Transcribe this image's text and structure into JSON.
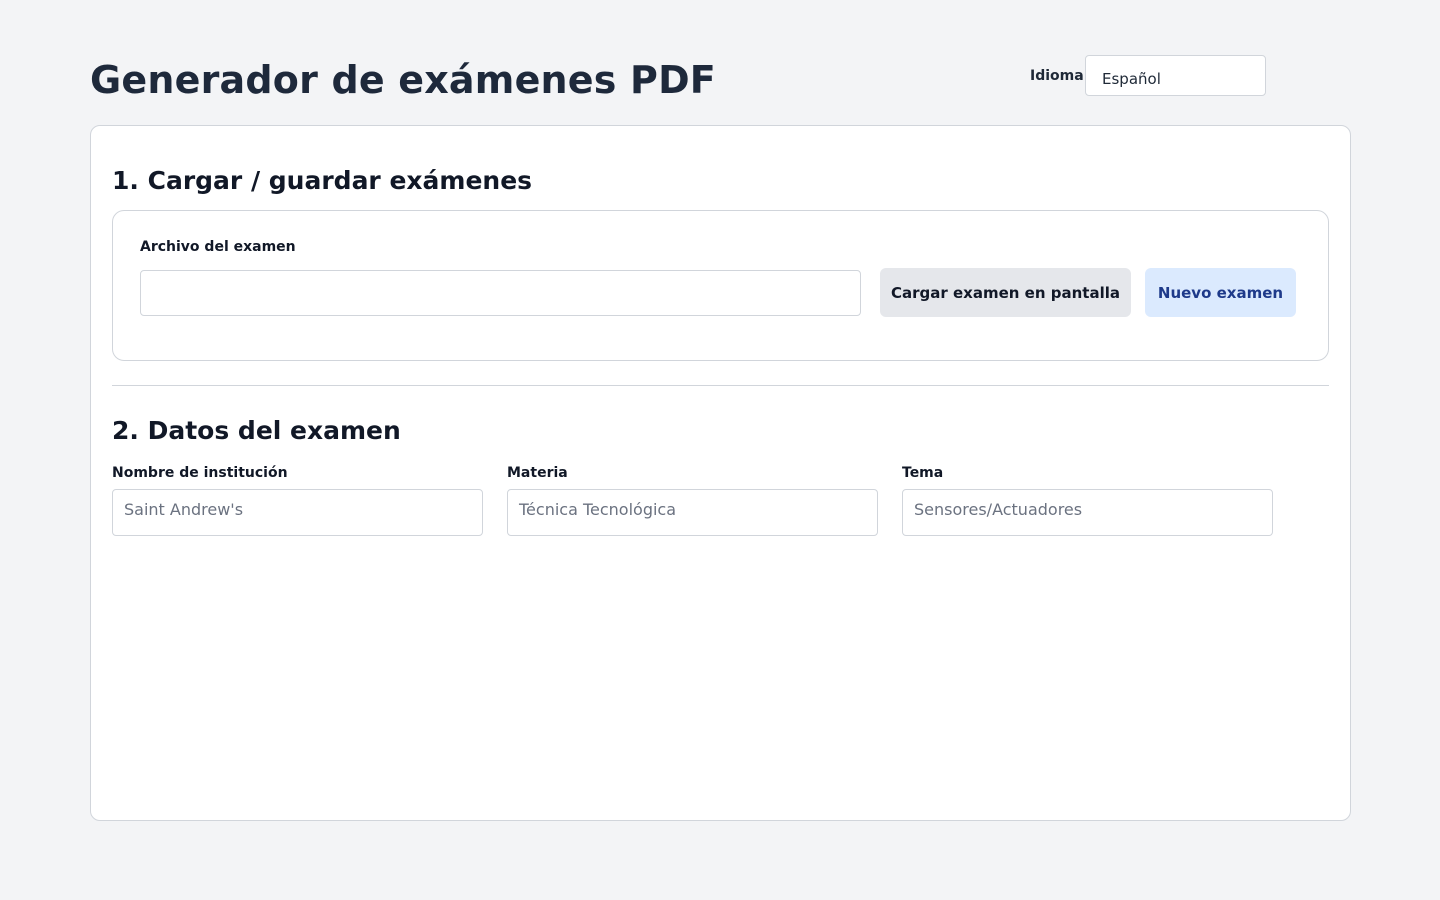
{
  "header": {
    "title": "Generador de exámenes PDF",
    "language_label": "Idioma",
    "language_value": "Español"
  },
  "section1": {
    "title": "1. Cargar / guardar exámenes",
    "file_label": "Archivo del examen",
    "file_value": "",
    "load_button": "Cargar examen en pantalla",
    "new_button": "Nuevo examen"
  },
  "section2": {
    "title": "2. Datos del examen",
    "fields": [
      {
        "label": "Nombre de institución",
        "placeholder": "Saint Andrew's"
      },
      {
        "label": "Materia",
        "placeholder": "Técnica Tecnológica"
      },
      {
        "label": "Tema",
        "placeholder": "Sensores/Actuadores"
      }
    ]
  },
  "colors": {
    "background": "#f3f4f6",
    "card": "#ffffff",
    "border": "#d1d5db",
    "load_button_bg": "#e5e7eb",
    "new_button_bg": "#dbeafe",
    "new_button_text": "#1e3a8a"
  }
}
